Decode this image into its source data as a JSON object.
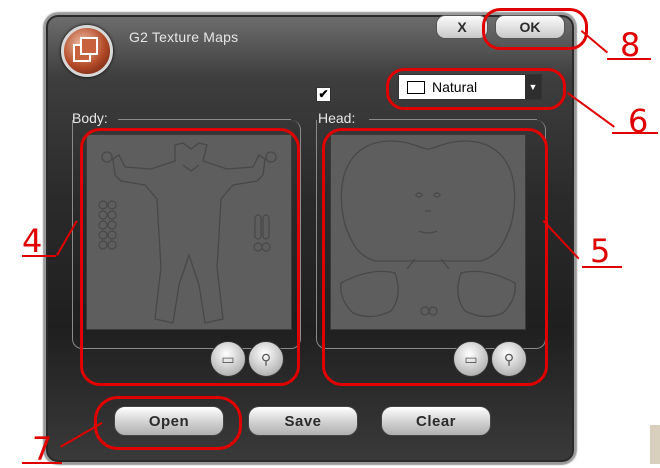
{
  "window": {
    "title": "G2 Texture Maps",
    "close_label": "X",
    "ok_label": "OK"
  },
  "texture_dropdown": {
    "selected": "Natural"
  },
  "head_checkbox": {
    "checked_mark": "✔"
  },
  "body_group": {
    "label": "Body:"
  },
  "head_group": {
    "label": "Head:"
  },
  "bottom_buttons": {
    "open": "Open",
    "save": "Save",
    "clear": "Clear"
  },
  "annotations": {
    "n4": "4",
    "n5": "5",
    "n6": "6",
    "n7": "7",
    "n8": "8",
    "color": "#e00000"
  },
  "icons": {
    "folder": "folder-icon",
    "zoom": "magnifier-icon"
  }
}
